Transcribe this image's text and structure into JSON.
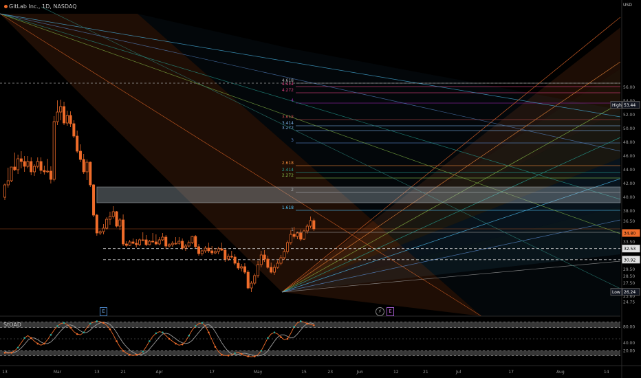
{
  "header": {
    "symbol": "GitLab Inc., 1D, NASDAQ"
  },
  "currency": "USD",
  "price_axis": {
    "ticks": [
      "56.00",
      "54.00",
      "52.00",
      "50.00",
      "48.00",
      "46.00",
      "44.00",
      "42.00",
      "40.00",
      "38.00",
      "36.50",
      "33.50",
      "30.00",
      "29.50",
      "28.50",
      "27.50",
      "25.60",
      "24.75"
    ],
    "tick_values": [
      56,
      54,
      52,
      50,
      48,
      46,
      44,
      42,
      40,
      38,
      36.5,
      33.5,
      31,
      29.5,
      28.5,
      27.5,
      25.6,
      24.75
    ],
    "badges": [
      {
        "label": "High",
        "value": "53.44",
        "price": 53.44,
        "color": "#ffffff",
        "bg": "#131722",
        "border": "#555555"
      },
      {
        "label": "",
        "value": "34.80",
        "price": 34.8,
        "color": "#000000",
        "bg": "#ef6c2a",
        "border": "#ef6c2a"
      },
      {
        "label": "",
        "value": "32.53",
        "price": 32.53,
        "color": "#000000",
        "bg": "#e0e0e0",
        "border": "#e0e0e0"
      },
      {
        "label": "",
        "value": "30.92",
        "price": 30.92,
        "color": "#000000",
        "bg": "#e0e0e0",
        "border": "#e0e0e0"
      },
      {
        "label": "Low",
        "value": "26.24",
        "price": 26.24,
        "color": "#ffffff",
        "bg": "#131722",
        "border": "#555555"
      }
    ]
  },
  "time_axis": {
    "labels": [
      {
        "text": "13",
        "day": 0
      },
      {
        "text": "Mar",
        "day": 16
      },
      {
        "text": "13",
        "day": 28
      },
      {
        "text": "21",
        "day": 36
      },
      {
        "text": "Apr",
        "day": 47
      },
      {
        "text": "17",
        "day": 63
      },
      {
        "text": "May",
        "day": 77
      },
      {
        "text": "15",
        "day": 91
      },
      {
        "text": "23",
        "day": 99
      },
      {
        "text": "Jun",
        "day": 108
      },
      {
        "text": "12",
        "day": 119
      },
      {
        "text": "21",
        "day": 128
      },
      {
        "text": "Jul",
        "day": 138
      },
      {
        "text": "17",
        "day": 154
      },
      {
        "text": "Aug",
        "day": 169
      },
      {
        "text": "14",
        "day": 183
      }
    ]
  },
  "fib_levels": [
    {
      "label": "4.618",
      "price": 56.6,
      "color": "#b0b0b0"
    },
    {
      "label": "4.414",
      "price": 56.1,
      "color": "#e04080"
    },
    {
      "label": "4.272",
      "price": 55.2,
      "color": "#e04080"
    },
    {
      "label": "4",
      "price": 53.7,
      "color": "#9c27b0"
    },
    {
      "label": "3.618",
      "price": 51.3,
      "color": "#b74a4a"
    },
    {
      "label": "3.414",
      "price": 50.4,
      "color": "#7bb0e8"
    },
    {
      "label": "3.272",
      "price": 49.7,
      "color": "#7bb0e8"
    },
    {
      "label": "3",
      "price": 47.9,
      "color": "#5a8bd0"
    },
    {
      "label": "2.618",
      "price": 44.6,
      "color": "#ef8a3a"
    },
    {
      "label": "2.414",
      "price": 43.6,
      "color": "#26a69a"
    },
    {
      "label": "2.272",
      "price": 42.8,
      "color": "#8bc34a"
    },
    {
      "label": "2",
      "price": 40.7,
      "color": "#9e9e9e"
    },
    {
      "label": "1.618",
      "price": 38.1,
      "color": "#4fc3f7"
    },
    {
      "label": "1",
      "price": 34.9,
      "color": "#9e9e9e"
    }
  ],
  "reference_lines": [
    32.53,
    30.92
  ],
  "zone": {
    "top": 41.5,
    "bottom": 39.2,
    "from_day": 28
  },
  "candles": [
    [
      40,
      42,
      39.6,
      41.8
    ],
    [
      41.8,
      44.3,
      41.4,
      42.4
    ],
    [
      42.4,
      43.8,
      42.2,
      44.4
    ],
    [
      44.4,
      46.5,
      43.8,
      44.0
    ],
    [
      44.0,
      46.2,
      43.4,
      45.6
    ],
    [
      45.6,
      46.7,
      44.2,
      45.2
    ],
    [
      45.2,
      46.0,
      43.7,
      44.5
    ],
    [
      44.5,
      46.0,
      44.2,
      45.2
    ],
    [
      45.2,
      45.8,
      43.2,
      43.7
    ],
    [
      43.7,
      44.8,
      43.1,
      44.5
    ],
    [
      44.5,
      45.8,
      44.2,
      45.2
    ],
    [
      45.2,
      45.8,
      43.4,
      43.9
    ],
    [
      43.9,
      44.6,
      43.3,
      43.7
    ],
    [
      43.7,
      45.6,
      43.5,
      43.8
    ],
    [
      43.8,
      44.5,
      42.0,
      42.6
    ],
    [
      42.6,
      51.8,
      42.3,
      51.0
    ],
    [
      51.0,
      54.1,
      50.5,
      52.4
    ],
    [
      52.4,
      54.2,
      51.2,
      53.2
    ],
    [
      53.2,
      53.9,
      50.5,
      50.8
    ],
    [
      50.8,
      52.6,
      50.4,
      51.9
    ],
    [
      51.9,
      52.5,
      50.2,
      50.7
    ],
    [
      50.7,
      51.2,
      48.6,
      48.9
    ],
    [
      48.9,
      49.7,
      46.4,
      46.7
    ],
    [
      46.7,
      47.7,
      45.1,
      45.5
    ],
    [
      45.5,
      46.3,
      43.4,
      43.7
    ],
    [
      43.7,
      45.5,
      42.5,
      45.1
    ],
    [
      45.1,
      45.2,
      41.5,
      41.8
    ],
    [
      41.8,
      41.9,
      37.1,
      37.4
    ],
    [
      37.4,
      37.6,
      34.4,
      34.8
    ],
    [
      34.8,
      35.2,
      34.5,
      35.0
    ],
    [
      35.0,
      36.1,
      34.6,
      35.5
    ],
    [
      35.5,
      37.1,
      35.3,
      36.8
    ],
    [
      36.8,
      37.9,
      36.0,
      37.2
    ],
    [
      37.2,
      38.7,
      36.9,
      37.9
    ],
    [
      37.9,
      38.0,
      35.6,
      35.8
    ],
    [
      35.8,
      37.0,
      35.2,
      36.7
    ],
    [
      36.7,
      37.5,
      32.9,
      33.2
    ],
    [
      33.2,
      33.6,
      32.8,
      33.0
    ],
    [
      33.0,
      33.8,
      32.9,
      33.5
    ],
    [
      33.5,
      34.0,
      33.2,
      33.3
    ],
    [
      33.3,
      33.9,
      32.7,
      33.1
    ],
    [
      33.1,
      34.0,
      32.9,
      33.8
    ],
    [
      33.8,
      34.9,
      33.6,
      33.8
    ],
    [
      33.8,
      34.5,
      32.9,
      33.1
    ],
    [
      33.1,
      33.8,
      33.0,
      33.6
    ],
    [
      33.6,
      34.8,
      33.4,
      33.5
    ],
    [
      33.5,
      34.6,
      33.0,
      33.2
    ],
    [
      33.2,
      34.2,
      33.0,
      33.8
    ],
    [
      33.8,
      34.8,
      33.6,
      34.2
    ],
    [
      34.2,
      34.5,
      32.5,
      32.9
    ],
    [
      32.9,
      33.3,
      32.7,
      33.1
    ],
    [
      33.1,
      33.6,
      32.8,
      33.3
    ],
    [
      33.3,
      34.2,
      33.1,
      33.3
    ],
    [
      33.3,
      34.2,
      33.1,
      33.6
    ],
    [
      33.6,
      34.0,
      32.3,
      32.6
    ],
    [
      32.6,
      33.2,
      32.2,
      32.9
    ],
    [
      32.9,
      33.7,
      32.7,
      33.4
    ],
    [
      33.4,
      34.4,
      33.2,
      34.3
    ],
    [
      34.3,
      34.5,
      32.6,
      32.8
    ],
    [
      32.8,
      33.2,
      31.5,
      31.8
    ],
    [
      31.8,
      32.4,
      31.5,
      32.2
    ],
    [
      32.2,
      32.9,
      31.9,
      32.6
    ],
    [
      32.6,
      33.4,
      31.9,
      32.2
    ],
    [
      32.2,
      32.9,
      31.6,
      31.9
    ],
    [
      31.9,
      32.6,
      31.7,
      32.1
    ],
    [
      32.1,
      32.8,
      31.7,
      32.5
    ],
    [
      32.5,
      33.4,
      32.2,
      32.3
    ],
    [
      32.3,
      32.5,
      30.6,
      31.0
    ],
    [
      31.0,
      31.8,
      30.7,
      31.4
    ],
    [
      31.4,
      32.2,
      31.1,
      31.3
    ],
    [
      31.3,
      31.7,
      30.1,
      30.4
    ],
    [
      30.4,
      30.8,
      29.4,
      29.7
    ],
    [
      29.7,
      30.3,
      29.2,
      29.9
    ],
    [
      29.9,
      30.4,
      28.8,
      29.1
    ],
    [
      29.1,
      29.4,
      26.6,
      26.8
    ],
    [
      26.8,
      27.8,
      26.2,
      27.5
    ],
    [
      27.5,
      28.9,
      27.2,
      28.6
    ],
    [
      28.6,
      30.7,
      28.3,
      30.2
    ],
    [
      30.2,
      32.2,
      29.8,
      31.6
    ],
    [
      31.6,
      32.3,
      30.6,
      31.0
    ],
    [
      31.0,
      31.5,
      29.6,
      29.8
    ],
    [
      29.8,
      30.5,
      28.9,
      29.1
    ],
    [
      29.1,
      30.2,
      28.7,
      29.8
    ],
    [
      29.8,
      30.8,
      29.6,
      30.4
    ],
    [
      30.4,
      31.6,
      30.1,
      31.2
    ],
    [
      31.2,
      32.5,
      30.9,
      32.1
    ],
    [
      32.1,
      33.7,
      31.8,
      33.4
    ],
    [
      33.4,
      35.2,
      33.1,
      34.6
    ],
    [
      34.6,
      35.7,
      34.0,
      34.3
    ],
    [
      34.3,
      35.0,
      33.9,
      34.8
    ],
    [
      34.8,
      35.3,
      33.6,
      33.9
    ],
    [
      33.9,
      35.3,
      33.8,
      35.1
    ],
    [
      35.1,
      36.1,
      34.7,
      35.8
    ],
    [
      35.8,
      37.2,
      35.5,
      36.6
    ],
    [
      36.6,
      36.9,
      35.1,
      35.4
    ]
  ],
  "oscillator": {
    "title": "StOAD",
    "ticks": [
      "80.00",
      "40.00",
      "20.00"
    ],
    "tick_values": [
      80,
      40,
      20
    ],
    "upper_band": [
      78,
      92
    ],
    "lower_band": [
      8,
      20
    ],
    "mid": 50,
    "k": [
      15,
      14,
      15,
      20,
      28,
      40,
      52,
      58,
      52,
      44,
      38,
      34,
      38,
      48,
      60,
      72,
      82,
      88,
      90,
      86,
      78,
      68,
      62,
      60,
      66,
      78,
      88,
      92,
      94,
      93,
      90,
      84,
      74,
      60,
      44,
      30,
      20,
      14,
      10,
      8,
      10,
      12,
      18,
      30,
      44,
      56,
      64,
      68,
      66,
      58,
      50,
      44,
      38,
      34,
      36,
      44,
      58,
      72,
      82,
      88,
      90,
      82,
      66,
      48,
      30,
      18,
      10,
      8,
      8,
      10,
      14,
      16,
      12,
      8,
      6,
      5,
      6,
      10,
      20,
      36,
      52,
      62,
      66,
      62,
      54,
      48,
      50,
      64,
      80,
      90,
      94,
      92,
      88,
      86,
      84
    ],
    "d": [
      18,
      16,
      15,
      16,
      20,
      27,
      36,
      46,
      52,
      52,
      48,
      42,
      38,
      38,
      42,
      50,
      60,
      70,
      78,
      84,
      85,
      82,
      76,
      70,
      65,
      66,
      72,
      80,
      86,
      90,
      92,
      90,
      86,
      78,
      66,
      52,
      40,
      30,
      22,
      16,
      12,
      10,
      12,
      16,
      24,
      34,
      44,
      54,
      62,
      64,
      62,
      56,
      50,
      44,
      40,
      38,
      40,
      46,
      56,
      66,
      76,
      84,
      86,
      80,
      68,
      54,
      40,
      28,
      18,
      12,
      10,
      11,
      13,
      14,
      12,
      10,
      8,
      7,
      8,
      12,
      20,
      32,
      44,
      54,
      60,
      60,
      56,
      52,
      54,
      62,
      72,
      82,
      88,
      90,
      88
    ]
  },
  "colors": {
    "bull": "#ef6c2a",
    "bear": "#ef6c2a",
    "accent": "#ef6c2a",
    "grid": "#1e1e1e"
  },
  "markers": {
    "earnings_left": "E",
    "flash": "⚡",
    "earnings_right": "E"
  }
}
